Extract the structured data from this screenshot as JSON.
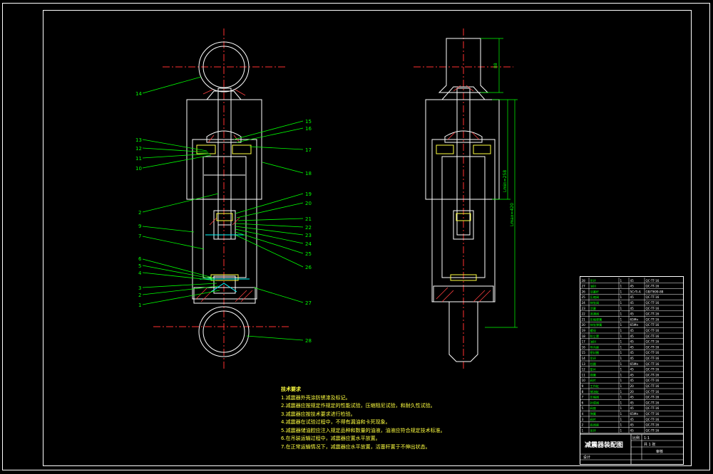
{
  "drawing": {
    "title": "减震器装配图",
    "left_callouts": [
      "14",
      "13",
      "12",
      "11",
      "10",
      "2",
      "9",
      "7",
      "6",
      "5",
      "4",
      "3",
      "2",
      "1"
    ],
    "right_callouts": [
      "15",
      "16",
      "17",
      "18",
      "19",
      "20",
      "21",
      "22",
      "23",
      "24",
      "25",
      "26",
      "27",
      "28"
    ],
    "side_dims": [
      "88",
      "Lmin=258",
      "Lmax=420"
    ]
  },
  "notes": {
    "heading": "技术要求",
    "items": [
      "1.减震器外壳涂防锈漆及标记。",
      "2.减震器应按规定作规定的性能试验，压缩阻尼试验，和耐久性试验。",
      "3.减震器应按技术要求进行检验。",
      "4.减震器在试验过程中，不得有漏油和卡死现象。",
      "5.减震器储油腔应注入规定品种和数量的油液，油液应符合规定技术标准。",
      "6.在吊装运输过程中，减震器应置水平放置。",
      "7.在正常运输情况下，减震器应水平放置，活塞杆置于不伸出状态。"
    ]
  },
  "title_block": {
    "rows": [
      [
        "28",
        "吊环",
        "1",
        "45",
        "QC-TT-16"
      ],
      [
        "27",
        "油封",
        "1",
        "45",
        "QC-TT-16"
      ],
      [
        "26",
        "活塞杆",
        "1",
        "5CrTi-A",
        "GB/T699-88"
      ],
      [
        "25",
        "压缩阀",
        "1",
        "45",
        "QC-TT-16"
      ],
      [
        "24",
        "伸张阀",
        "1",
        "45",
        "QC-TT-16"
      ],
      [
        "23",
        "活塞",
        "1",
        "45",
        "QC-TT-16"
      ],
      [
        "22",
        "流通阀",
        "1",
        "45",
        "QC-TT-16"
      ],
      [
        "21",
        "压缩弹簧",
        "1",
        "65Mn",
        "QC-TT-16"
      ],
      [
        "20",
        "伸张弹簧",
        "1",
        "65Mn",
        "QC-TT-16"
      ],
      [
        "19",
        "螺母",
        "1",
        "45",
        "QC-TT-16"
      ],
      [
        "18",
        "防尘罩",
        "1",
        "45",
        "QC-TT-16"
      ],
      [
        "17",
        "油封",
        "1",
        "45",
        "QC-TT-16"
      ],
      [
        "16",
        "导向座",
        "1",
        "45",
        "QC-TT-16"
      ],
      [
        "15",
        "密封圈",
        "1",
        "45",
        "QC-TT-16"
      ],
      [
        "14",
        "吊环",
        "1",
        "45",
        "QC-TT-16"
      ],
      [
        "13",
        "挡圈",
        "1",
        "65Mn",
        "QC-TT-16"
      ],
      [
        "12",
        "垫片",
        "1",
        "45",
        "QC-TT-16"
      ],
      [
        "11",
        "弹簧",
        "1",
        "45",
        "QC-TT-16"
      ],
      [
        "10",
        "阀片",
        "1",
        "45",
        "QC-TT-16"
      ],
      [
        "9",
        "工作缸",
        "1",
        "20",
        "QC-TT-16"
      ],
      [
        "8",
        "储油缸",
        "1",
        "20",
        "QC-TT-16"
      ],
      [
        "7",
        "压缩阀",
        "1",
        "45",
        "QC-TT-16"
      ],
      [
        "6",
        "补偿阀",
        "1",
        "45",
        "QC-TT-16"
      ],
      [
        "5",
        "阀座",
        "1",
        "45",
        "QC-TT-16"
      ],
      [
        "4",
        "弹簧",
        "1",
        "65Mn",
        "QC-TT-16"
      ],
      [
        "3",
        "阀片",
        "1",
        "45",
        "QC-TT-16"
      ],
      [
        "2",
        "底阀座",
        "1",
        "45",
        "QC-TT-16"
      ],
      [
        "1",
        "吊环",
        "1",
        "45",
        "QC-TT-16"
      ]
    ],
    "scale_label": "比例",
    "scale": "1:1",
    "sheet_label": "共 1 张",
    "designer_label": "设计",
    "checker_label": "审核"
  }
}
